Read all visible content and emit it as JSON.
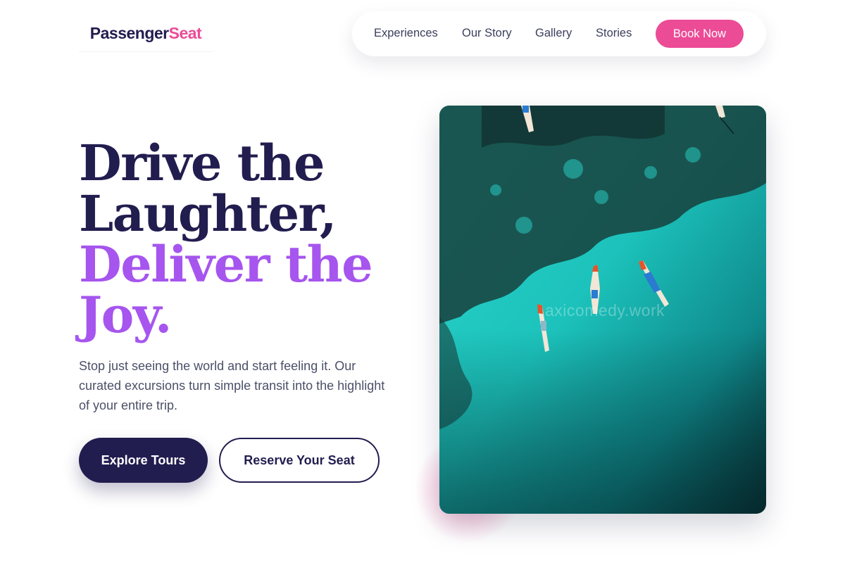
{
  "brand": {
    "part1": "Passenger",
    "part2": "Seat",
    "accent_color": "#ec4b96",
    "dark_color": "#221d4f"
  },
  "nav": {
    "links": [
      "Experiences",
      "Our Story",
      "Gallery",
      "Stories"
    ],
    "cta": "Book Now"
  },
  "hero": {
    "headline_line1": "Drive the",
    "headline_line2": "Laughter,",
    "headline_line3": "Deliver the",
    "headline_line4": "Joy.",
    "headline_accent_color": "#a655ee",
    "subtext": "Stop just seeing the world and start feeling it. Our curated excursions turn simple transit into the highlight of your entire trip.",
    "primary_button": "Explore Tours",
    "secondary_button": "Reserve Your Seat"
  },
  "image": {
    "alt": "Aerial view of longtail boats on turquoise water over a coral reef",
    "watermark": "axicomedy.work"
  }
}
